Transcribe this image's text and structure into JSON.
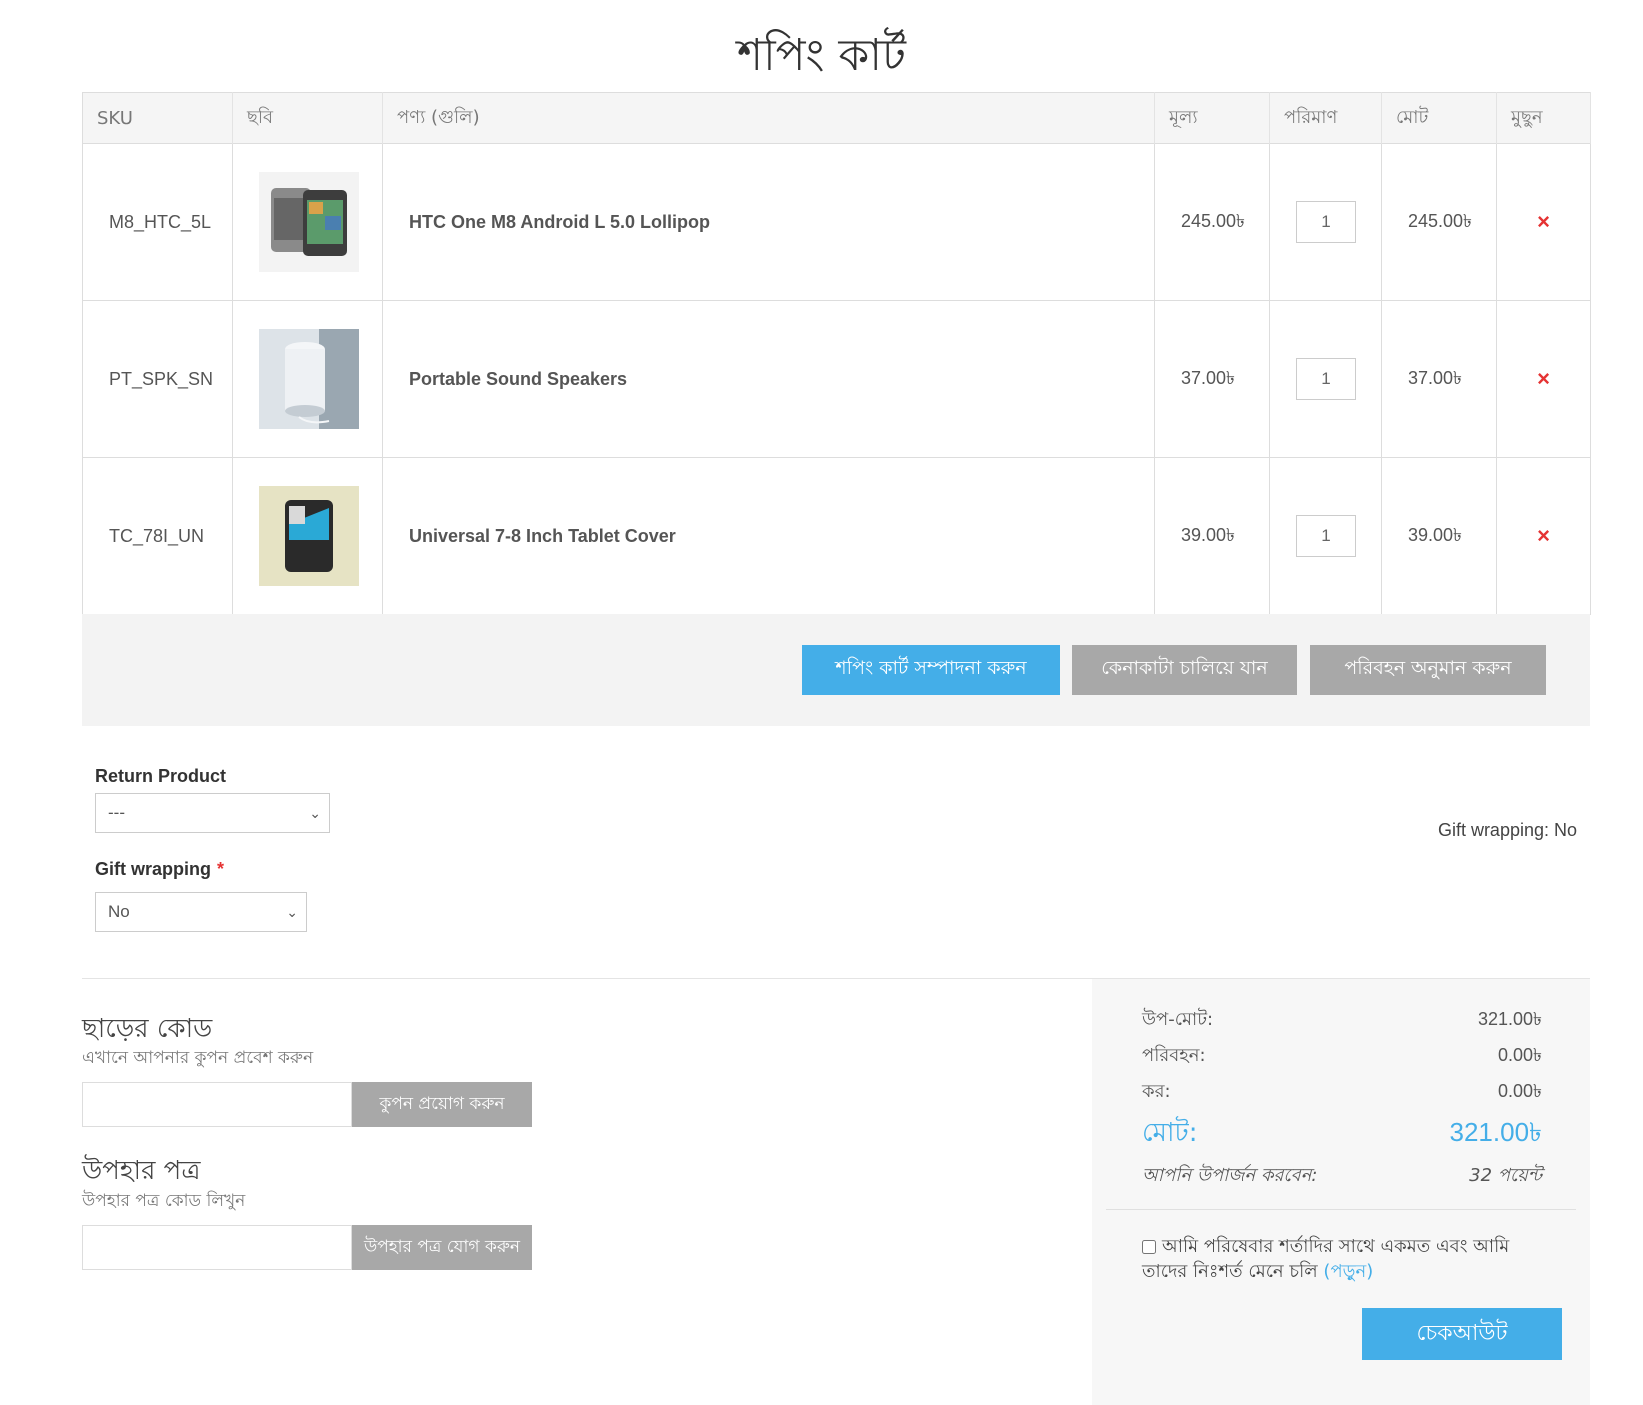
{
  "page": {
    "title": "শপিং কার্ট"
  },
  "cart": {
    "headers": {
      "sku": "SKU",
      "image": "ছবি",
      "product": "পণ্য (গুলি)",
      "price": "মূল্য",
      "quantity": "পরিমাণ",
      "total": "মোট",
      "remove": "মুছুন"
    },
    "rows": [
      {
        "sku": "M8_HTC_5L",
        "name": "HTC One M8 Android L 5.0 Lollipop",
        "price": "245.00৳",
        "quantity": "1",
        "total": "245.00৳",
        "image_icon": "phone-image",
        "remove_icon": "×"
      },
      {
        "sku": "PT_SPK_SN",
        "name": "Portable Sound Speakers",
        "price": "37.00৳",
        "quantity": "1",
        "total": "37.00৳",
        "image_icon": "speaker-image",
        "remove_icon": "×"
      },
      {
        "sku": "TC_78I_UN",
        "name": "Universal 7-8 Inch Tablet Cover",
        "price": "39.00৳",
        "quantity": "1",
        "total": "39.00৳",
        "image_icon": "tablet-cover-image",
        "remove_icon": "×"
      }
    ]
  },
  "actions": {
    "update_cart": "শপিং কার্ট সম্পাদনা করুন",
    "continue_shopping": "কেনাকাটা চালিয়ে যান",
    "estimate_shipping": "পরিবহন অনুমান করুন"
  },
  "attributes": {
    "return_product": {
      "label": "Return Product",
      "value": "---"
    },
    "gift_wrapping": {
      "label": "Gift wrapping",
      "required_mark": "*",
      "value": "No"
    },
    "gift_summary": "Gift wrapping: No"
  },
  "coupon": {
    "title": "ছাড়ের কোড",
    "subtitle": "এখানে আপনার কুপন প্রবেশ করুন",
    "input_value": "",
    "button": "কুপন প্রয়োগ করুন"
  },
  "gift_card": {
    "title": "উপহার পত্র",
    "subtitle": "উপহার পত্র কোড লিখুন",
    "input_value": "",
    "button": "উপহার পত্র যোগ করুন"
  },
  "totals": {
    "subtotal_label": "উপ-মোট:",
    "subtotal_value": "321.00৳",
    "shipping_label": "পরিবহন:",
    "shipping_value": "0.00৳",
    "tax_label": "কর:",
    "tax_value": "0.00৳",
    "total_label": "মোট:",
    "total_value": "321.00৳",
    "points_label": "আপনি উপার্জন করবেন:",
    "points_value": "32 পয়েন্ট"
  },
  "terms": {
    "text": "আমি পরিষেবার শর্তাদির সাথে একমত এবং আমি তাদের নিঃশর্ত মেনে চলি",
    "link": "(পড়ুন)",
    "checked": false
  },
  "checkout": {
    "label": "চেকআউট"
  },
  "colors": {
    "accent": "#44aee8",
    "gray_button": "#a8a8a8",
    "remove": "#e53333"
  }
}
